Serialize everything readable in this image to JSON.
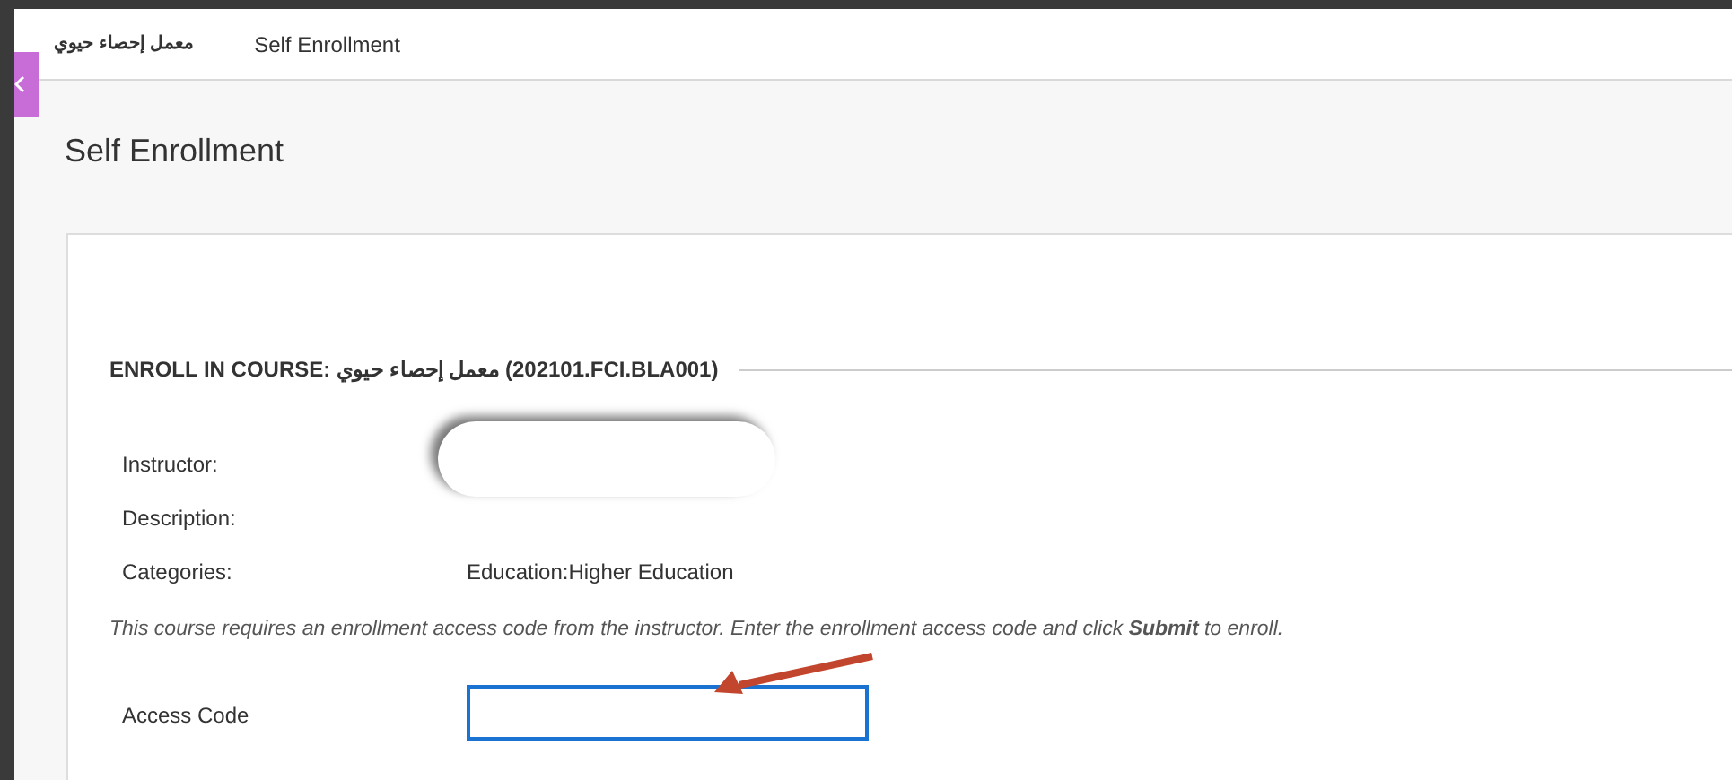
{
  "breadcrumbs": [
    {
      "label": "معمل إحصاء حيوي"
    },
    {
      "label": "Self Enrollment"
    }
  ],
  "page_title": "Self Enrollment",
  "section": {
    "label": "ENROLL IN COURSE:",
    "course": "معمل إحصاء حيوي (202101.FCI.BLA001)"
  },
  "fields": [
    {
      "label": "Instructor:",
      "kind": "redacted"
    },
    {
      "label": "Description:",
      "kind": "empty"
    },
    {
      "label": "Categories:",
      "kind": "text",
      "value": "Education:Higher Education"
    }
  ],
  "instructions": "This course requires an enrollment access code from the instructor. Enter the enrollment access code and click **Submit** to enroll.",
  "access_code": {
    "label": "Access Code"
  }
}
